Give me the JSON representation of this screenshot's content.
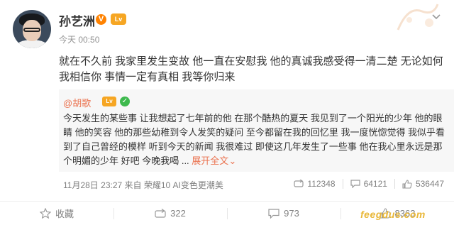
{
  "post": {
    "author": "孙艺洲",
    "badge_v": "V",
    "badge_level": "Lv",
    "timestamp": "今天 00:50",
    "text": "就在不久前 我家里发生变故 他一直在安慰我 他的真诚我感受得一清二楚 无论如何 我相信你 事情一定有真相 我等你归来"
  },
  "retweet": {
    "author": "@胡歌",
    "badge_level": "Lv",
    "badge_check": "✓",
    "text": "今天发生的某些事 让我想起了七年前的他 在那个酷热的夏天 我见到了一个阳光的少年 他的眼睛 他的笑容 他的那些幼稚到令人发笑的疑问 至今都留在我的回忆里 我一度恍惚觉得 我似乎看到了自己曾经的模样 听到今天的新闻 我很难过 即使这几年发生了一些事 他在我心里永远是那个明媚的少年 好吧 今晚我喝 ... ",
    "expand_label": "展开全文",
    "expand_chevron": "⌄",
    "meta": "11月28日 23:27 来自 荣耀10 AI变色更潮美",
    "shares": "112348",
    "comments": "64121",
    "likes": "536447"
  },
  "actions": {
    "favorite_label": "收藏",
    "repost_count": "322",
    "comment_count": "973",
    "like_count": "8363"
  },
  "watermark": "feegdus.com",
  "colors": {
    "accent": "#eb7350",
    "vip_orange": "#ff8200",
    "retweet_bg": "#f7f7f7"
  },
  "icons": [
    "chevron-down-icon",
    "favorite-icon",
    "repost-icon",
    "comment-icon",
    "like-icon"
  ]
}
